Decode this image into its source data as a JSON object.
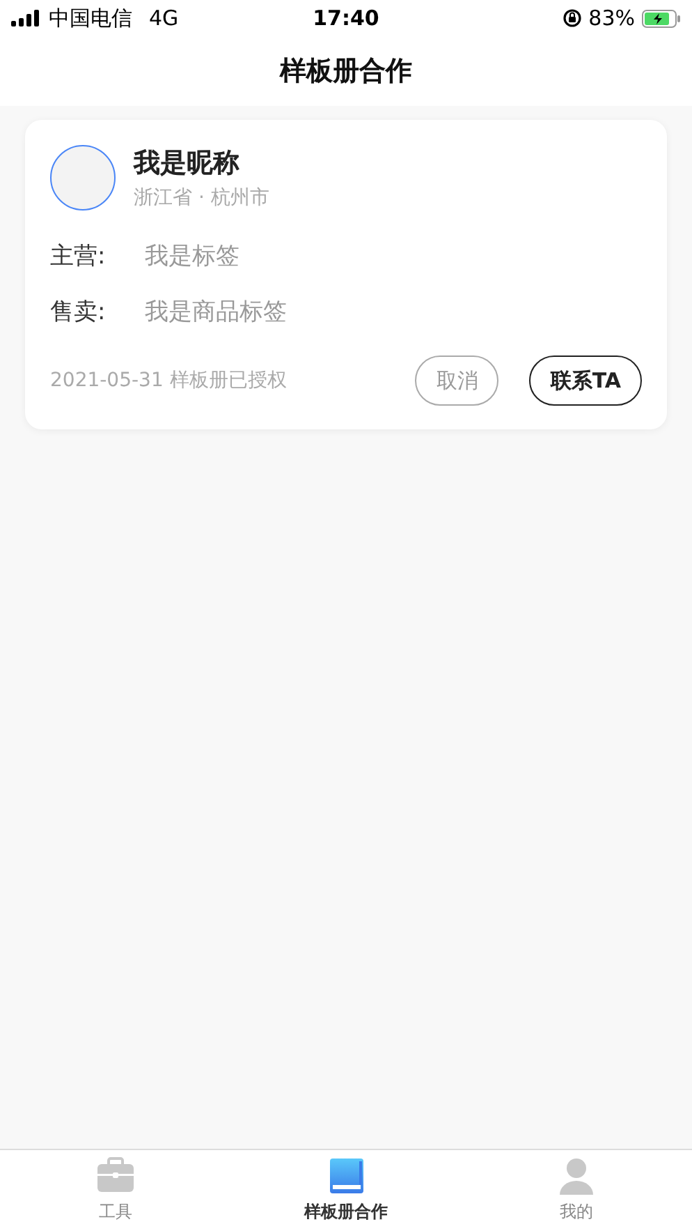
{
  "status_bar": {
    "carrier": "中国电信",
    "network": "4G",
    "time": "17:40",
    "battery": "83%"
  },
  "nav_bar": {
    "title": "样板册合作"
  },
  "card": {
    "nickname": "我是昵称",
    "location": "浙江省 · 杭州市",
    "fields": [
      {
        "label": "主营:",
        "value": "我是标签"
      },
      {
        "label": "售卖:",
        "value": "我是商品标签"
      }
    ],
    "note": "2021-05-31 样板册已授权",
    "buttons": [
      {
        "label": "取消",
        "kind": "secondary"
      },
      {
        "label": "联系TA",
        "kind": "primary"
      }
    ]
  },
  "tab_bar": [
    {
      "label": "工具",
      "kind": "toolbox",
      "selected": false
    },
    {
      "label": "样板册合作",
      "kind": "book",
      "selected": true
    },
    {
      "label": "我的",
      "kind": "person",
      "selected": false
    }
  ]
}
